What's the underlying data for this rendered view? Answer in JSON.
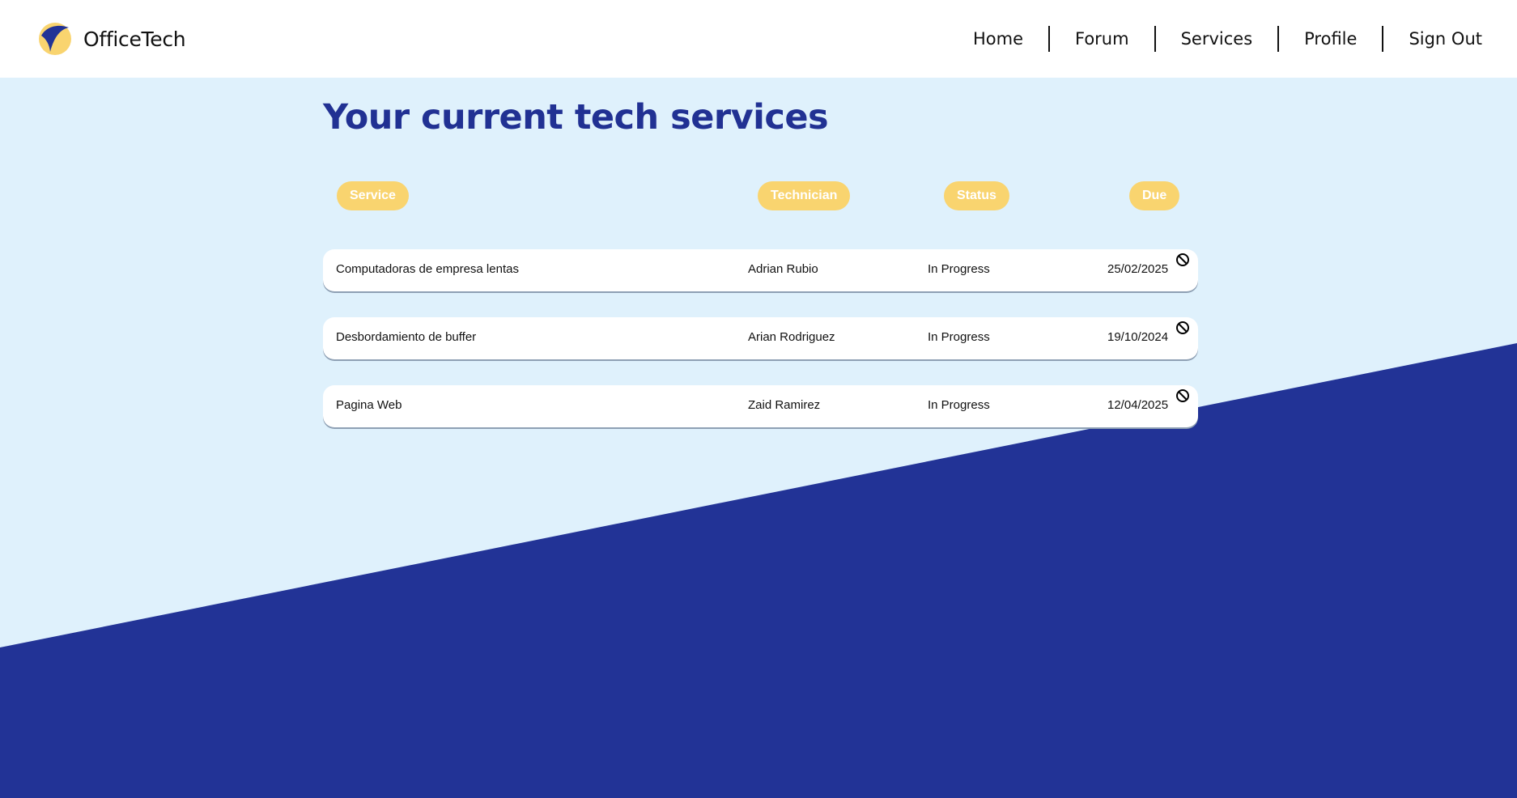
{
  "brand": {
    "name": "OfficeTech",
    "logo_icon": "officetech-logo-icon"
  },
  "nav": [
    {
      "label": "Home"
    },
    {
      "label": "Forum"
    },
    {
      "label": "Services"
    },
    {
      "label": "Profile"
    },
    {
      "label": "Sign Out"
    }
  ],
  "page": {
    "title": "Your current tech services"
  },
  "columns": {
    "service": "Service",
    "technician": "Technician",
    "status": "Status",
    "due": "Due"
  },
  "services": [
    {
      "service": "Computadoras de empresa lentas",
      "technician": "Adrian Rubio",
      "status": "In Progress",
      "due": "25/02/2025",
      "action_icon": "cancel-icon"
    },
    {
      "service": "Desbordamiento de buffer",
      "technician": "Arian Rodriguez",
      "status": "In Progress",
      "due": "19/10/2024",
      "action_icon": "cancel-icon"
    },
    {
      "service": "Pagina Web",
      "technician": "Zaid Ramirez",
      "status": "In Progress",
      "due": "12/04/2025",
      "action_icon": "cancel-icon"
    }
  ],
  "colors": {
    "primary": "#213193",
    "accent": "#f9d46f",
    "background": "#dff1fc",
    "surface": "#ffffff"
  }
}
